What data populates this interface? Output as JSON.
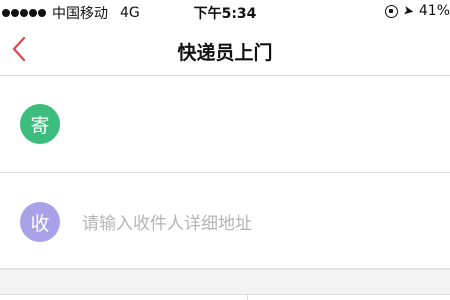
{
  "status_bar": {
    "carrier": "中国移动",
    "network": "4G",
    "time": "下午5:34",
    "battery": "41%"
  },
  "nav": {
    "title": "快递员上门"
  },
  "sender": {
    "icon_char": "寄",
    "icon_color": "#3cbd7e"
  },
  "receiver": {
    "icon_char": "收",
    "icon_color": "#a7a2e8",
    "address_placeholder": "请输入收件人详细地址"
  },
  "colors": {
    "accent_back": "#e0464b",
    "placeholder_gray": "#b5b5b5"
  }
}
